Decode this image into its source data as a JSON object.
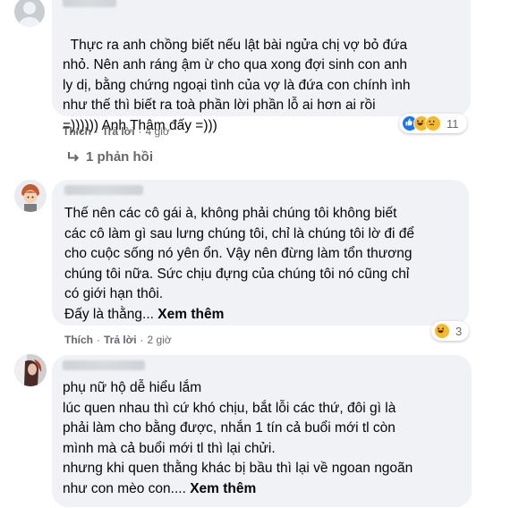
{
  "comments": [
    {
      "text": "Thực ra anh chồng biết nếu lật bài ngửa chị vợ bỏ đứa\nnhỏ. Nên anh ráng ậm ừ cho qua xong đợi sinh con anh\nly dị, bằng chứng ngoại tình của vợ là đứa con chính ình\nnhư thế thì biết ra toà phần lời phần lỗ ai hơn ai rồi\n=)))))) Anh Thâm đấy =)))",
      "see_more": "",
      "like_label": "Thích",
      "reply_label": "Trả lời",
      "time": "4 giờ",
      "reaction_count": "11",
      "reactions": [
        "like-icon",
        "haha-icon",
        "sad-icon"
      ]
    },
    {
      "text": "Thế nên các cô gái à, không phải chúng tôi không biết\ncác cô làm gì sau lưng chúng tôi, chỉ là chúng tôi lờ đi để\ncho cuộc sống nó yên ổn. Vậy nên đừng làm tổn thương\nchúng tôi nữa. Sức chịu đựng của chúng tôi nó cũng chỉ\ncó giới hạn thôi.\nĐấy là thằng... ",
      "see_more": "Xem thêm",
      "like_label": "Thích",
      "reply_label": "Trả lời",
      "time": "2 giờ",
      "reaction_count": "3",
      "reactions": [
        "haha-icon"
      ]
    },
    {
      "text": "phụ nữ hộ dễ hiểu lắm\nlúc quen nhau thì cứ khó chịu, bắt lỗi các thứ, đôi gì là\nphải làm cho bằng được, nhắn 1 tín cả buổi mới tl còn\nmình mà cả buổi mới tl thì lại chửi.\nnhưng khi quen thằng khác bị bầu thì lại về ngoan ngoãn\nnhư con mèo con.... ",
      "see_more": "Xem thêm"
    }
  ],
  "replies_label": "1 phản hồi",
  "colors": {
    "bubble": "#f0f2f5",
    "text": "#050505",
    "meta": "#65676b",
    "like_blue": "#1877f2",
    "haha_yellow": "#f7b928"
  }
}
